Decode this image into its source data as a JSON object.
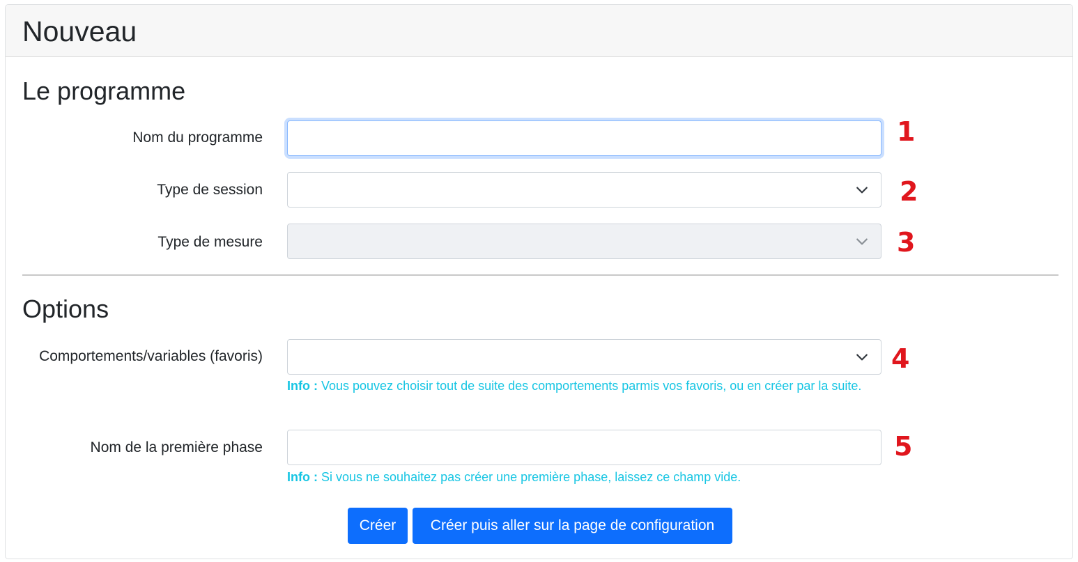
{
  "card": {
    "title": "Nouveau"
  },
  "sections": {
    "programme": "Le programme",
    "options": "Options"
  },
  "fields": {
    "program_name": {
      "label": "Nom du programme",
      "value": ""
    },
    "session_type": {
      "label": "Type de session",
      "value": ""
    },
    "measure_type": {
      "label": "Type de mesure",
      "value": ""
    },
    "behaviors": {
      "label": "Comportements/variables (favoris)",
      "value": "",
      "help_prefix": "Info :",
      "help_text": " Vous pouvez choisir tout de suite des comportements parmis vos favoris, ou en créer par la suite."
    },
    "first_phase": {
      "label": "Nom de la première phase",
      "value": "",
      "help_prefix": "Info :",
      "help_text": " Si vous ne souhaitez pas créer une première phase, laissez ce champ vide."
    }
  },
  "annotations": [
    "1",
    "2",
    "3",
    "4",
    "5"
  ],
  "buttons": {
    "create": "Créer",
    "create_configure": "Créer puis aller sur la page de configuration"
  },
  "colors": {
    "primary": "#0d6efd",
    "info": "#16c5e3",
    "annotation": "#e0161d",
    "disabled_bg": "#eff1f4",
    "header_bg": "#f7f7f7"
  },
  "icons": {
    "select_arrow": "chevron-down-icon"
  }
}
